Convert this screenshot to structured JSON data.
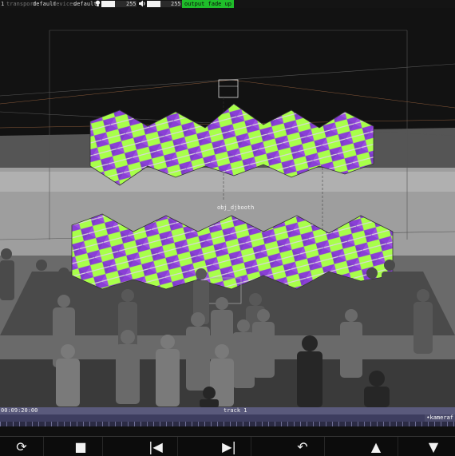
{
  "topbar": {
    "index": "1",
    "transport_label": "transport",
    "transport_value": "default",
    "devices_label": "devices",
    "devices_value": "default",
    "light_icon": "bulb-icon",
    "light_value": "255",
    "sound_icon": "speaker-icon",
    "sound_value": "255",
    "light_level": 1.0,
    "sound_level": 1.0,
    "output_label": "output",
    "fade_label": "fade up",
    "fade_color": "#1fbd2a"
  },
  "scene": {
    "object_label": "obj_djbooth",
    "pattern_colors": [
      "#a8ff4a",
      "#8a3fd6",
      "#e8e8e8"
    ]
  },
  "timeline": {
    "time": "00:09:20:00",
    "track": "track 1",
    "camera": "•kameraf"
  },
  "transport": {
    "buttons": [
      {
        "name": "loop-icon",
        "glyph": "⟳"
      },
      {
        "name": "stop-icon",
        "glyph": "■"
      },
      {
        "name": "skip-back-icon",
        "glyph": "|◀"
      },
      {
        "name": "play-icon",
        "glyph": "▶|"
      },
      {
        "name": "undo-icon",
        "glyph": "↶"
      },
      {
        "name": "up-icon",
        "glyph": "▲"
      },
      {
        "name": "down-icon",
        "glyph": "▼"
      }
    ]
  }
}
